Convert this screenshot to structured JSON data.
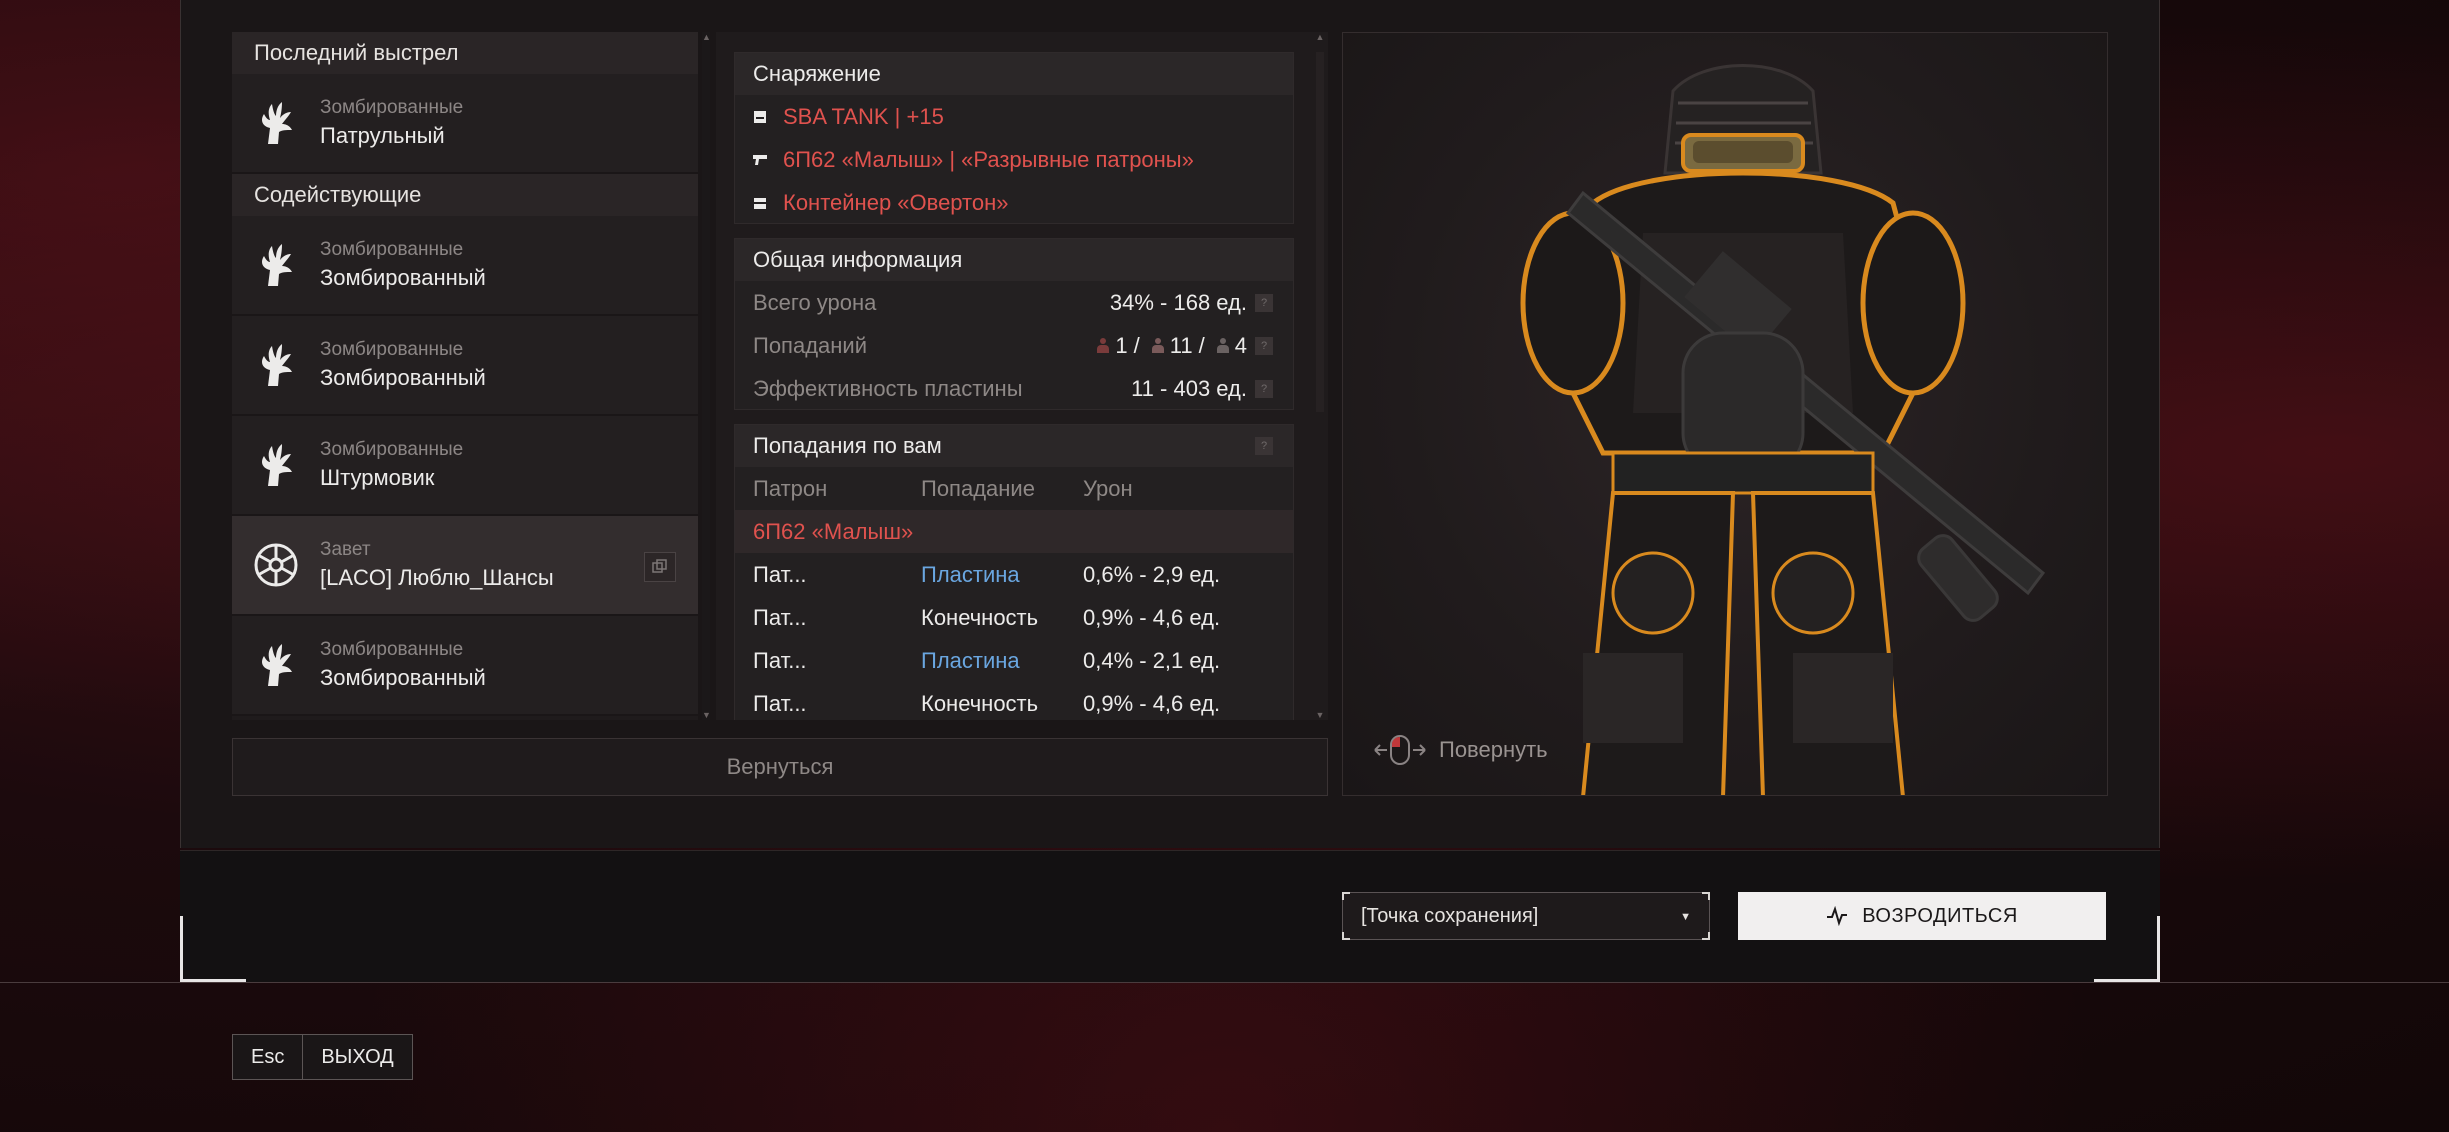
{
  "left": {
    "last_shot_header": "Последний выстрел",
    "last_shot": {
      "faction": "Зомбированные",
      "name": "Патрульный"
    },
    "assist_header": "Содействующие",
    "assists": [
      {
        "faction": "Зомбированные",
        "name": "Зомбированный",
        "icon": "zombie-hand-icon"
      },
      {
        "faction": "Зомбированные",
        "name": "Зомбированный",
        "icon": "zombie-hand-icon"
      },
      {
        "faction": "Зомбированные",
        "name": "Штурмовик",
        "icon": "zombie-hand-icon"
      },
      {
        "faction": "Завет",
        "name": "[LACO] Люблю_Шансы",
        "icon": "covenant-emblem-icon",
        "selected": true
      },
      {
        "faction": "Зомбированные",
        "name": "Зомбированный",
        "icon": "zombie-hand-icon"
      }
    ]
  },
  "equipment": {
    "header": "Снаряжение",
    "items": [
      {
        "icon": "armor-icon",
        "label": "SBA TANK | +15"
      },
      {
        "icon": "gun-icon",
        "label": "6П62 «Малыш» | «Разрывные патроны»"
      },
      {
        "icon": "container-icon",
        "label": "Контейнер «Овертон»"
      }
    ]
  },
  "general": {
    "header": "Общая информация",
    "total_damage_label": "Всего урона",
    "total_damage_value": "34% - 168 ед.",
    "hits_label": "Попаданий",
    "hits_values": [
      "1",
      "11",
      "4"
    ],
    "hits_sep": "/",
    "plate_label": "Эффективность пластины",
    "plate_value": "11 - 403 ед.",
    "help": "?"
  },
  "hits_on_you": {
    "header": "Попадания по вам",
    "col_ammo": "Патрон",
    "col_hit": "Попадание",
    "col_damage": "Урон",
    "weapon": "6П62 «Малыш»",
    "rows": [
      {
        "ammo": "Пат...",
        "hit": "Пластина",
        "damage": "0,6% - 2,9 ед.",
        "plate": true
      },
      {
        "ammo": "Пат...",
        "hit": "Конечность",
        "damage": "0,9% - 4,6 ед.",
        "plate": false
      },
      {
        "ammo": "Пат...",
        "hit": "Пластина",
        "damage": "0,4% - 2,1 ед.",
        "plate": true
      },
      {
        "ammo": "Пат...",
        "hit": "Конечность",
        "damage": "0,9% - 4,6 ед.",
        "plate": false
      }
    ]
  },
  "return_label": "Вернуться",
  "rotate_label": "Повернуть",
  "spawn_point": "[Точка сохранения]",
  "respawn_label": "ВОЗРОДИТЬСЯ",
  "esc_key": "Esc",
  "exit_label": "ВЫХОД",
  "colors": {
    "accent_red": "#e0524e",
    "plate_blue": "#6aa6e0",
    "armor_orange": "#d98a1e"
  }
}
